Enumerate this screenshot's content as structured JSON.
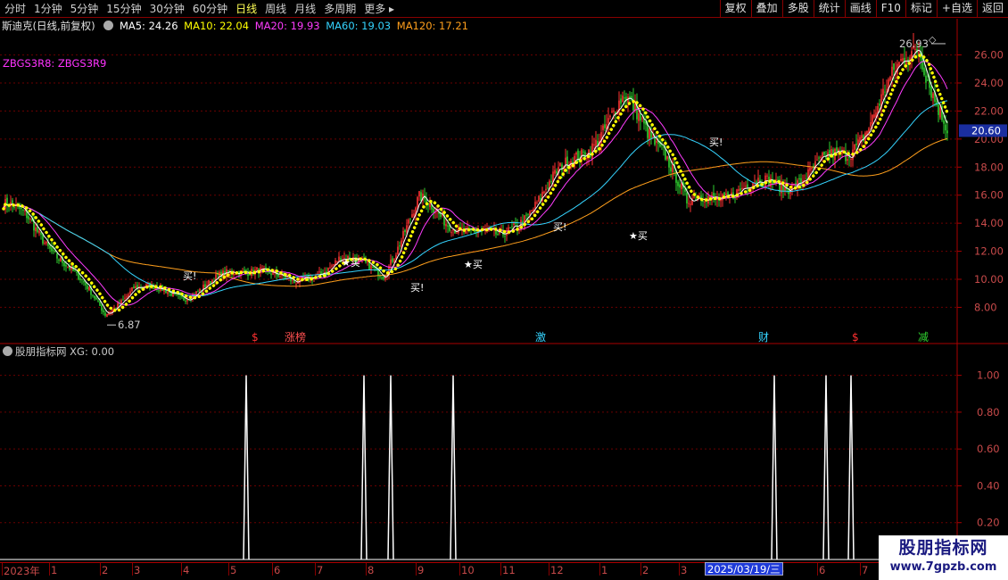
{
  "toolbar": {
    "period_tabs": [
      "分时",
      "1分钟",
      "5分钟",
      "15分钟",
      "30分钟",
      "60分钟",
      "日线",
      "周线",
      "月线",
      "多周期",
      "更多"
    ],
    "active_tab": "日线",
    "more_arrow": "▸",
    "buttons": [
      "复权",
      "叠加",
      "多股",
      "统计",
      "画线",
      "F10",
      "标记",
      "+自选",
      "返回"
    ]
  },
  "legend": {
    "title": "斯迪克(日线,前复权)",
    "icon": "circle-icon",
    "ma5": "MA5: 24.26",
    "ma10": "MA10: 22.04",
    "ma20": "MA20: 19.93",
    "ma60": "MA60: 19.03",
    "ma120": "MA120: 17.21"
  },
  "formula_label": "ZBGS3R8: ZBGS3R9",
  "sub_legend": "股朋指标网 XG: 0.00",
  "colors": {
    "up": "#ff3232",
    "down": "#2fd12f",
    "ma5": "#ffffff",
    "ma10": "#ffff00",
    "ma20": "#ff3cff",
    "ma60": "#35d4ff",
    "ma120": "#ff9f1c",
    "signal": "#ffffff",
    "grid": "#6b0000",
    "price_tag_bg": "#1a2ea0"
  },
  "price_axis": {
    "ticks": [
      "26.00",
      "24.00",
      "22.00",
      "20.00",
      "18.00",
      "16.00",
      "14.00",
      "12.00",
      "10.00",
      "8.00"
    ],
    "current_price": "20.60",
    "high_label": "26.93",
    "low_label": "6.87",
    "high_value": 26.93,
    "low_value": 6.87
  },
  "indicator_axis": {
    "ticks": [
      "1.00",
      "0.80",
      "0.60",
      "0.40",
      "0.20"
    ]
  },
  "date_axis": {
    "labels": [
      "2023年",
      "1",
      "2",
      "3",
      "4",
      "5",
      "6",
      "7",
      "8",
      "9",
      "10",
      "11",
      "12",
      "1",
      "2",
      "3",
      "5",
      "6",
      "7"
    ],
    "crosshair_date": "2025/03/19/三"
  },
  "event_markers": [
    {
      "text": "$",
      "color": "#ff3030"
    },
    {
      "text": "涨榜",
      "color": "#ff5050"
    },
    {
      "text": "激",
      "color": "#35d4ff"
    },
    {
      "text": "财",
      "color": "#35d4ff"
    },
    {
      "text": "$",
      "color": "#ff3030"
    },
    {
      "text": "减",
      "color": "#2fd12f"
    }
  ],
  "buy_signal_text": "★买",
  "buy_marker_text": "买!",
  "chart_data": {
    "type": "candlestick",
    "title": "斯迪克(日线,前复权)",
    "ylim": [
      6.5,
      27.5
    ],
    "price_keypoints": [
      {
        "date": "2023-01",
        "close": 15.6
      },
      {
        "date": "2023-02",
        "close": 14.2
      },
      {
        "date": "2023-03",
        "close": 11.5
      },
      {
        "date": "2023-04",
        "close": 7.5
      },
      {
        "date": "2023-04",
        "close": 9.5
      },
      {
        "date": "2023-05",
        "close": 8.8
      },
      {
        "date": "2023-06",
        "close": 10.0
      },
      {
        "date": "2023-07",
        "close": 11.0
      },
      {
        "date": "2023-08",
        "close": 9.5
      },
      {
        "date": "2023-09",
        "close": 11.5
      },
      {
        "date": "2023-10",
        "close": 10.5
      },
      {
        "date": "2023-11",
        "close": 15.5
      },
      {
        "date": "2023-12",
        "close": 14.2
      },
      {
        "date": "2024-01",
        "close": 12.8
      },
      {
        "date": "2024-02",
        "close": 15.5
      },
      {
        "date": "2024-03",
        "close": 22.5
      },
      {
        "date": "2024-04",
        "close": 19.5
      },
      {
        "date": "2024-05",
        "close": 15.2
      },
      {
        "date": "2024-06",
        "close": 16.5
      },
      {
        "date": "2024-07",
        "close": 16.8
      },
      {
        "date": "2024-08",
        "close": 19.0
      },
      {
        "date": "2024-09",
        "close": 26.9
      },
      {
        "date": "2024-09",
        "close": 20.6
      }
    ],
    "indicator": {
      "name": "XG",
      "ylim": [
        0,
        1.1
      ],
      "signal_dates": [
        "2023-05",
        "2023-08",
        "2023-08",
        "2023-10",
        "2025-03",
        "2025-06",
        "2025-06"
      ]
    }
  }
}
